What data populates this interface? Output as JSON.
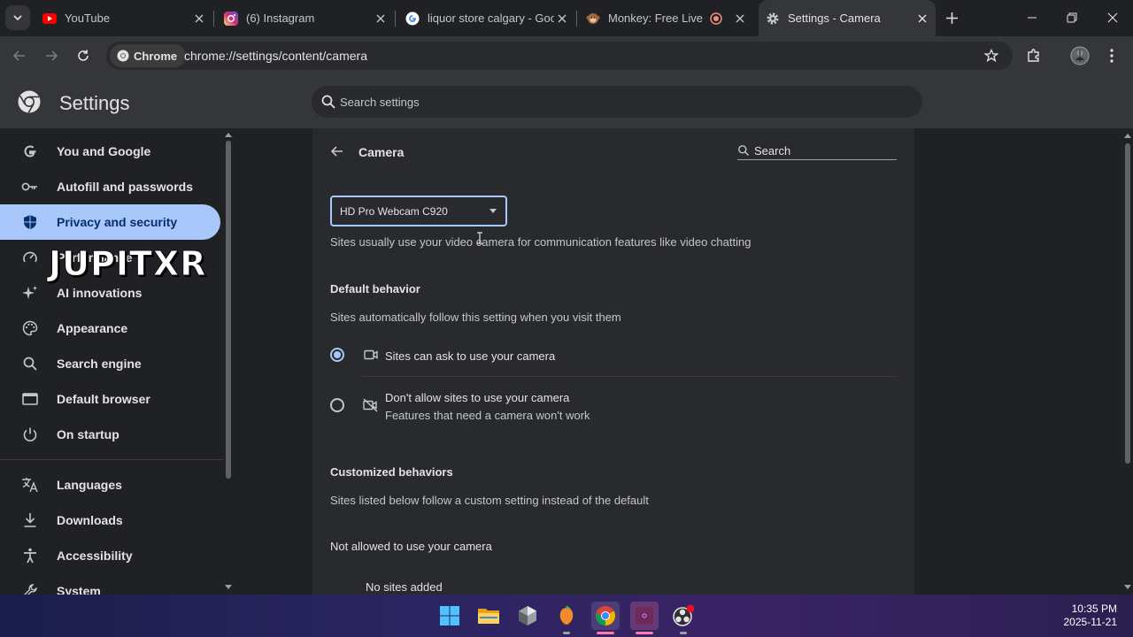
{
  "tabs": [
    {
      "title": "YouTube",
      "icon": "youtube-icon"
    },
    {
      "title": "(6) Instagram",
      "icon": "instagram-icon"
    },
    {
      "title": "liquor store calgary - Goo",
      "icon": "google-icon"
    },
    {
      "title": "Monkey: Free Live Vi",
      "icon": "monkey-icon"
    },
    {
      "title": "Settings - Camera",
      "icon": "gear-icon",
      "active": true
    }
  ],
  "toolbar": {
    "chip_label": "Chrome",
    "url": "chrome://settings/content/camera"
  },
  "header": {
    "title": "Settings",
    "search_placeholder": "Search settings"
  },
  "sidebar": {
    "items": [
      {
        "label": "You and Google",
        "icon": "google-g-icon"
      },
      {
        "label": "Autofill and passwords",
        "icon": "key-icon"
      },
      {
        "label": "Privacy and security",
        "icon": "shield-icon",
        "selected": true
      },
      {
        "label": "Performance",
        "icon": "speedometer-icon"
      },
      {
        "label": "AI innovations",
        "icon": "sparkle-icon"
      },
      {
        "label": "Appearance",
        "icon": "palette-icon"
      },
      {
        "label": "Search engine",
        "icon": "search-icon"
      },
      {
        "label": "Default browser",
        "icon": "browser-window-icon"
      },
      {
        "label": "On startup",
        "icon": "power-icon"
      },
      {
        "label": "Languages",
        "icon": "translate-icon"
      },
      {
        "label": "Downloads",
        "icon": "download-icon"
      },
      {
        "label": "Accessibility",
        "icon": "accessibility-icon"
      },
      {
        "label": "System",
        "icon": "wrench-icon"
      }
    ]
  },
  "watermark": "JUPITXR",
  "camera": {
    "title": "Camera",
    "search_placeholder": "Search",
    "device": "HD Pro Webcam C920",
    "description": "Sites usually use your video camera for communication features like video chatting",
    "default_heading": "Default behavior",
    "default_desc": "Sites automatically follow this setting when you visit them",
    "option_allow": "Sites can ask to use your camera",
    "option_block": "Don't allow sites to use your camera",
    "option_block_sub": "Features that need a camera won't work",
    "selected_option": "allow",
    "custom_heading": "Customized behaviors",
    "custom_desc": "Sites listed below follow a custom setting instead of the default",
    "not_allowed_heading": "Not allowed to use your camera",
    "no_sites": "No sites added"
  },
  "taskbar": {
    "apps": [
      "windows-start-icon",
      "file-explorer-icon",
      "app-hexagon-icon",
      "fl-studio-icon",
      "chrome-icon",
      "pink-app-icon",
      "obs-icon"
    ],
    "time": "10:35 PM",
    "date": "2025-11-21"
  },
  "colors": {
    "accent": "#a8c7fa",
    "background": "#202124",
    "card": "#292a2d"
  }
}
